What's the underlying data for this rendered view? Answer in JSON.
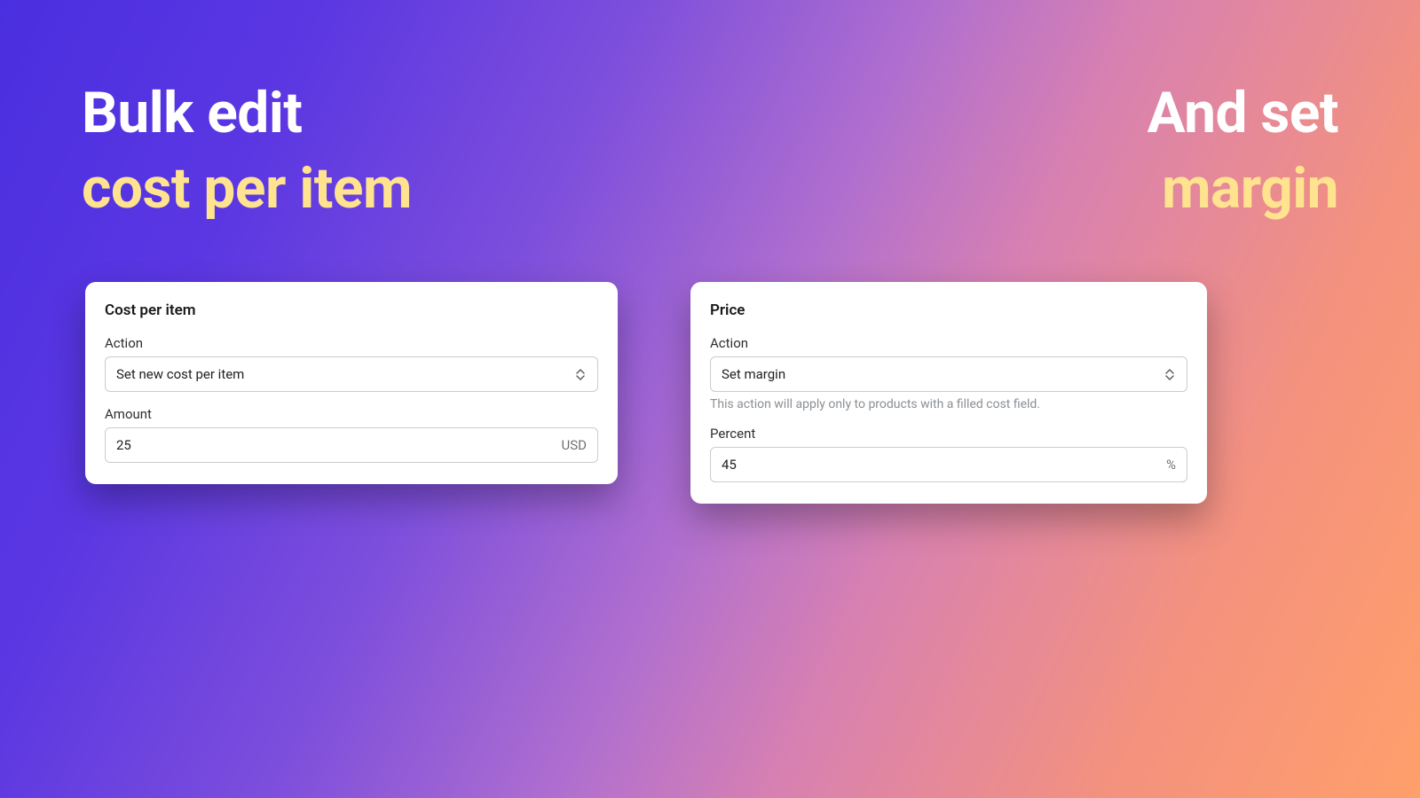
{
  "hero": {
    "left_line1": "Bulk edit",
    "left_line2": "cost per item",
    "right_line1": "And set",
    "right_line2": "margin"
  },
  "cost_card": {
    "title": "Cost per item",
    "action_label": "Action",
    "action_value": "Set new cost per item",
    "amount_label": "Amount",
    "amount_value": "25",
    "amount_suffix": "USD"
  },
  "price_card": {
    "title": "Price",
    "action_label": "Action",
    "action_value": "Set margin",
    "action_helper": "This action will apply only to products with a filled cost field.",
    "percent_label": "Percent",
    "percent_value": "45",
    "percent_suffix": "%"
  }
}
